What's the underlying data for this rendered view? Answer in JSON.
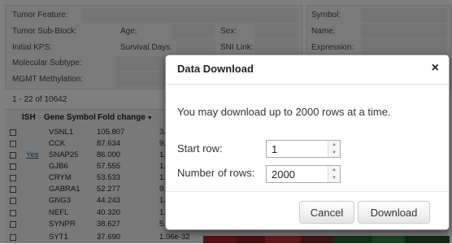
{
  "tumor_panel": {
    "tumor_feature_label": "Tumor Feature:",
    "tumor_sub_block_label": "Tumor Sub-Block:",
    "age_label": "Age:",
    "sex_label": "Sex:",
    "initial_kps_label": "Initial KPS:",
    "survival_days_label": "Survival Days:",
    "sni_link_label": "SNI Link:",
    "molecular_subtype_label": "Molecular Subtype:",
    "mgmt_methylation_label": "MGMT Methylation:"
  },
  "gene_panel": {
    "symbol_label": "Symbol:",
    "name_label": "Name:",
    "expression_label": "Expression:"
  },
  "results": {
    "row_count": "1 - 22 of 10642",
    "columns": [
      "ISH",
      "Gene Symbol",
      "Fold change"
    ],
    "rows": [
      {
        "ish": "",
        "gene": "VSNL1",
        "fold": "105.807",
        "p": "3."
      },
      {
        "ish": "",
        "gene": "CCK",
        "fold": "87.634",
        "p": "9."
      },
      {
        "ish": "Yes",
        "gene": "SNAP25",
        "fold": "86.000",
        "p": "1."
      },
      {
        "ish": "",
        "gene": "GJB6",
        "fold": "57.555",
        "p": "1."
      },
      {
        "ish": "",
        "gene": "CRYM",
        "fold": "53.533",
        "p": "1."
      },
      {
        "ish": "",
        "gene": "GABRA1",
        "fold": "52.277",
        "p": "9."
      },
      {
        "ish": "",
        "gene": "GNG3",
        "fold": "44.243",
        "p": "1."
      },
      {
        "ish": "",
        "gene": "NEFL",
        "fold": "40.320",
        "p": "1."
      },
      {
        "ish": "",
        "gene": "SYNPR",
        "fold": "38.627",
        "p": "5."
      },
      {
        "ish": "",
        "gene": "SYT1",
        "fold": "37.690",
        "p": "1.06e-32"
      }
    ]
  },
  "dialog": {
    "title": "Data Download",
    "close_glyph": "×",
    "message": "You may download up to 2000 rows at a time.",
    "start_row_label": "Start row:",
    "start_row_value": "1",
    "num_rows_label": "Number of rows:",
    "num_rows_value": "2000",
    "cancel_label": "Cancel",
    "download_label": "Download"
  },
  "icons": {
    "spin_up": "spin-up-icon",
    "spin_down": "spin-down-icon",
    "sort": "sort-desc-icon",
    "close": "close-icon"
  },
  "colors": {
    "link": "#3355aa",
    "overlay": "rgba(0,0,0,0.5)",
    "heatmap_red": "#b2222a",
    "heatmap_green": "#1f6b2c"
  }
}
